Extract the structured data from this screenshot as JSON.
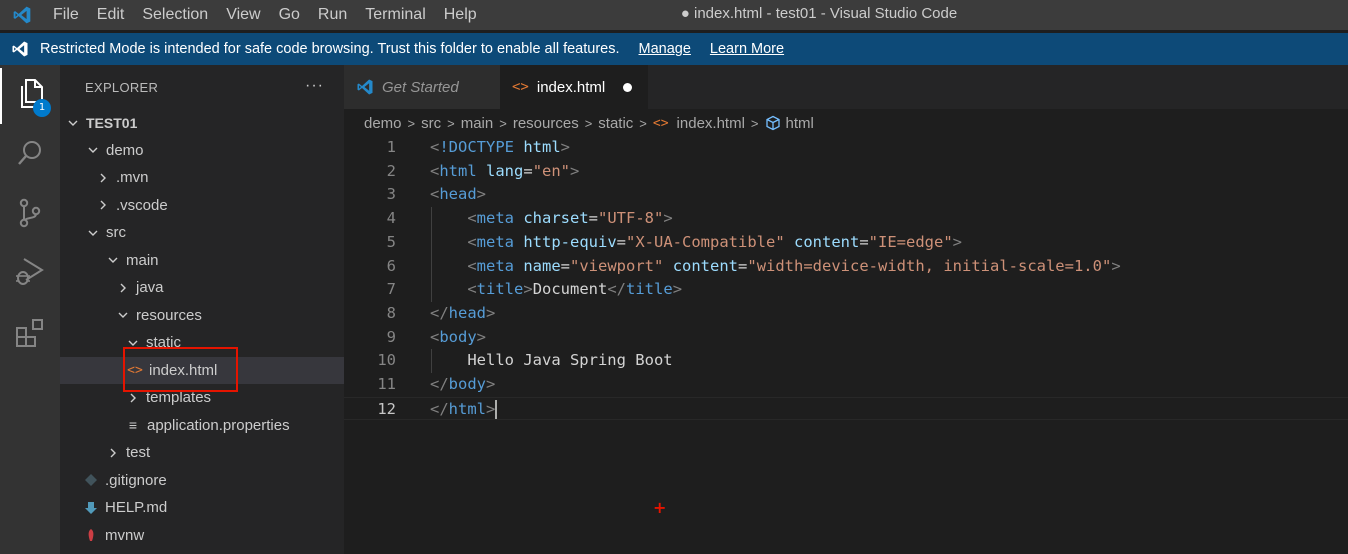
{
  "titlebar": {
    "menu": [
      "File",
      "Edit",
      "Selection",
      "View",
      "Go",
      "Run",
      "Terminal",
      "Help"
    ],
    "window_title": "● index.html - test01 - Visual Studio Code"
  },
  "banner": {
    "message": "Restricted Mode is intended for safe code browsing. Trust this folder to enable all features.",
    "manage": "Manage",
    "learn_more": "Learn More"
  },
  "activitybar": {
    "explorer_badge": "1"
  },
  "sidebar": {
    "title": "EXPLORER",
    "more": "···",
    "tree": [
      {
        "label": "TEST01",
        "type": "folder-open",
        "root": true
      },
      {
        "label": "demo",
        "type": "folder-open"
      },
      {
        "label": ".mvn",
        "type": "folder-closed"
      },
      {
        "label": ".vscode",
        "type": "folder-closed"
      },
      {
        "label": "src",
        "type": "folder-open"
      },
      {
        "label": "main",
        "type": "folder-open"
      },
      {
        "label": "java",
        "type": "folder-closed"
      },
      {
        "label": "resources",
        "type": "folder-open"
      },
      {
        "label": "static",
        "type": "folder-open"
      },
      {
        "label": "index.html",
        "type": "file-html",
        "selected": true
      },
      {
        "label": "templates",
        "type": "folder-closed"
      },
      {
        "label": "application.properties",
        "type": "file-lines"
      },
      {
        "label": "test",
        "type": "folder-closed"
      },
      {
        "label": ".gitignore",
        "type": "file-git"
      },
      {
        "label": "HELP.md",
        "type": "file-md"
      },
      {
        "label": "mvnw",
        "type": "file-mvnw"
      }
    ]
  },
  "tabs": [
    {
      "label": "Get Started",
      "active": false
    },
    {
      "label": "index.html",
      "active": true,
      "dirty": true
    }
  ],
  "breadcrumb": [
    "demo",
    "src",
    "main",
    "resources",
    "static",
    "index.html",
    "html"
  ],
  "editor": {
    "current_line": 12,
    "lines": [
      [
        [
          "t-punc",
          "<"
        ],
        [
          "t-tag",
          "!DOCTYPE"
        ],
        [
          "t-text",
          " "
        ],
        [
          "t-attr",
          "html"
        ],
        [
          "t-punc",
          ">"
        ]
      ],
      [
        [
          "t-punc",
          "<"
        ],
        [
          "t-tag",
          "html"
        ],
        [
          "t-text",
          " "
        ],
        [
          "t-attr",
          "lang"
        ],
        [
          "t-text",
          "="
        ],
        [
          "t-str",
          "\"en\""
        ],
        [
          "t-punc",
          ">"
        ]
      ],
      [
        [
          "t-punc",
          "<"
        ],
        [
          "t-tag",
          "head"
        ],
        [
          "t-punc",
          ">"
        ]
      ],
      [
        [
          "t-text",
          "    "
        ],
        [
          "t-punc",
          "<"
        ],
        [
          "t-tag",
          "meta"
        ],
        [
          "t-text",
          " "
        ],
        [
          "t-attr",
          "charset"
        ],
        [
          "t-text",
          "="
        ],
        [
          "t-str",
          "\"UTF-8\""
        ],
        [
          "t-punc",
          ">"
        ]
      ],
      [
        [
          "t-text",
          "    "
        ],
        [
          "t-punc",
          "<"
        ],
        [
          "t-tag",
          "meta"
        ],
        [
          "t-text",
          " "
        ],
        [
          "t-attr",
          "http-equiv"
        ],
        [
          "t-text",
          "="
        ],
        [
          "t-str",
          "\"X-UA-Compatible\""
        ],
        [
          "t-text",
          " "
        ],
        [
          "t-attr",
          "content"
        ],
        [
          "t-text",
          "="
        ],
        [
          "t-str",
          "\"IE=edge\""
        ],
        [
          "t-punc",
          ">"
        ]
      ],
      [
        [
          "t-text",
          "    "
        ],
        [
          "t-punc",
          "<"
        ],
        [
          "t-tag",
          "meta"
        ],
        [
          "t-text",
          " "
        ],
        [
          "t-attr",
          "name"
        ],
        [
          "t-text",
          "="
        ],
        [
          "t-str",
          "\"viewport\""
        ],
        [
          "t-text",
          " "
        ],
        [
          "t-attr",
          "content"
        ],
        [
          "t-text",
          "="
        ],
        [
          "t-str",
          "\"width=device-width, initial-scale=1.0\""
        ],
        [
          "t-punc",
          ">"
        ]
      ],
      [
        [
          "t-text",
          "    "
        ],
        [
          "t-punc",
          "<"
        ],
        [
          "t-tag",
          "title"
        ],
        [
          "t-punc",
          ">"
        ],
        [
          "t-text",
          "Document"
        ],
        [
          "t-punc",
          "</"
        ],
        [
          "t-tag",
          "title"
        ],
        [
          "t-punc",
          ">"
        ]
      ],
      [
        [
          "t-punc",
          "</"
        ],
        [
          "t-tag",
          "head"
        ],
        [
          "t-punc",
          ">"
        ]
      ],
      [
        [
          "t-punc",
          "<"
        ],
        [
          "t-tag",
          "body"
        ],
        [
          "t-punc",
          ">"
        ]
      ],
      [
        [
          "t-text",
          "    Hello Java Spring Boot"
        ]
      ],
      [
        [
          "t-punc",
          "</"
        ],
        [
          "t-tag",
          "body"
        ],
        [
          "t-punc",
          ">"
        ]
      ],
      [
        [
          "t-punc",
          "</"
        ],
        [
          "t-tag",
          "html"
        ],
        [
          "t-punc",
          ">"
        ]
      ]
    ]
  },
  "colors": {
    "accent": "#007acc",
    "banner": "#0d4a78",
    "highlight_box": "#e51400",
    "html_icon": "#e37933"
  }
}
